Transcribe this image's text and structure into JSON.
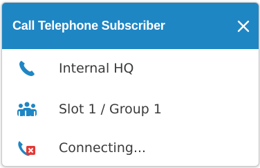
{
  "dialog": {
    "title": "Call Telephone Subscriber",
    "close_icon": "close-icon"
  },
  "rows": [
    {
      "icon": "phone-icon",
      "label": "Internal HQ"
    },
    {
      "icon": "group-icon",
      "label": "Slot 1 / Group 1"
    },
    {
      "icon": "call-failed-icon",
      "label": "Connecting..."
    }
  ],
  "colors": {
    "title_bar": "#1f86c4",
    "icon_blue": "#1f86c4",
    "icon_red": "#e53935",
    "text": "#3a3a3a"
  }
}
